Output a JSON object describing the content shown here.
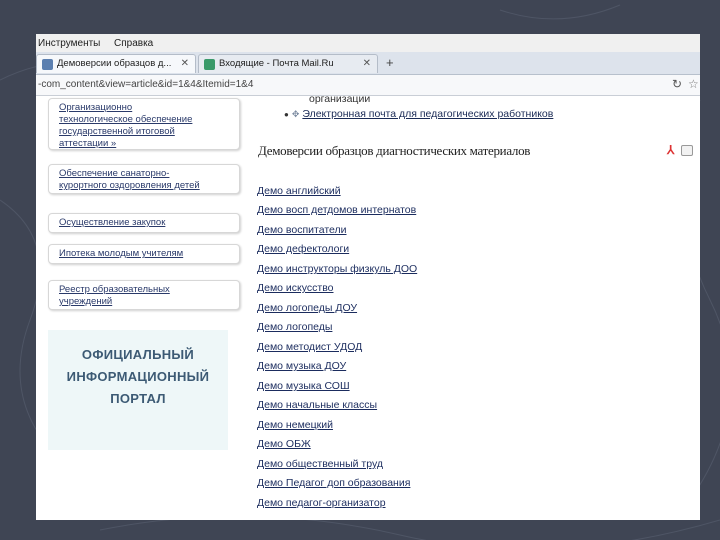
{
  "browser": {
    "menu": [
      "Инструменты",
      "Справка"
    ],
    "tabs": [
      {
        "label": "Демоверсии образцов д..."
      },
      {
        "label": "Входящие - Почта Mail.Ru"
      }
    ],
    "new_tab_label": "+",
    "url": "-com_content&view=article&id=1&4&Itemid=1&4"
  },
  "sidebar": {
    "items": [
      {
        "lines": [
          "Организационно",
          "технологическое обеспечение",
          "государственной итоговой",
          "аттестации »"
        ]
      },
      {
        "lines": [
          "Обеспечение санаторно-",
          "курортного оздоровления детей"
        ]
      },
      {
        "lines": [
          "Осуществление закупок"
        ]
      },
      {
        "lines": [
          "Ипотека молодым учителям"
        ]
      },
      {
        "lines": [
          "Реестр образовательных",
          "учреждений"
        ]
      }
    ],
    "portal_lines": [
      "ОФИЦИАЛЬНЫЙ",
      "ИНФОРМАЦИОННЫЙ",
      "ПОРТАЛ"
    ]
  },
  "main": {
    "top_text": "организации",
    "email_link": "Электронная почта для педагогических работников",
    "heading": "Демоверсии образцов диагностических материалов",
    "demo_links": [
      "Демо английский",
      "Демо восп детдомов интернатов",
      "Демо воспитатели",
      "Демо дефектологи",
      "Демо инструкторы физкуль ДОО",
      "Демо искусство",
      "Демо логопеды ДОУ",
      "Демо логопеды",
      "Демо методист УДОД",
      "Демо музыка ДОУ",
      "Демо музыка СОШ",
      "Демо начальные классы",
      "Демо немецкий",
      "Демо ОБЖ",
      "Демо общественный труд",
      "Демо Педагог доп образования",
      "Демо педагог-организатор"
    ]
  },
  "colors": {
    "background": "#3f4554",
    "link": "#1b2c5e",
    "portal_text": "#3c5a74"
  }
}
